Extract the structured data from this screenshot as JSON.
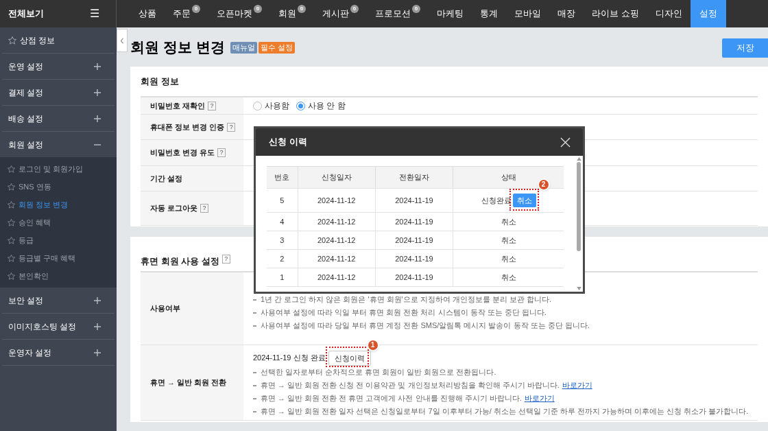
{
  "top_nav": {
    "all_menu_label": "전체보기",
    "menu_icon": "☰",
    "tabs": [
      {
        "label": "상품",
        "selected": false
      },
      {
        "label": "주문",
        "badge": "0",
        "selected": false
      },
      {
        "label": "오픈마켓",
        "badge": "0",
        "selected": false
      },
      {
        "label": "회원",
        "badge": "0",
        "selected": false
      },
      {
        "label": "게시판",
        "badge": "0",
        "selected": false
      },
      {
        "label": "프로모션",
        "badge": "0",
        "selected": false
      },
      {
        "label": "마케팅",
        "selected": false
      },
      {
        "label": "통계",
        "selected": false
      },
      {
        "label": "모바일",
        "selected": false
      },
      {
        "label": "매장",
        "selected": false
      },
      {
        "label": "라이브 쇼핑",
        "selected": false
      },
      {
        "label": "디자인",
        "selected": false
      },
      {
        "label": "설정",
        "selected": true
      }
    ]
  },
  "sidebar": {
    "items": [
      {
        "kind": "favorite",
        "label": "상점 정보"
      },
      {
        "kind": "group",
        "label": "운영 설정",
        "expanded": false
      },
      {
        "kind": "group",
        "label": "결제 설정",
        "expanded": false
      },
      {
        "kind": "group",
        "label": "배송 설정",
        "expanded": false
      },
      {
        "kind": "group",
        "label": "회원 설정",
        "expanded": true,
        "children": [
          {
            "label": "로그인 및 회원가입",
            "selected": false
          },
          {
            "label": "SNS 연동",
            "selected": false
          },
          {
            "label": "회원 정보 변경",
            "selected": true
          },
          {
            "label": "승인 혜택",
            "selected": false
          },
          {
            "label": "등급",
            "selected": false
          },
          {
            "label": "등급별 구매 혜택",
            "selected": false
          },
          {
            "label": "본인확인",
            "selected": false
          }
        ]
      },
      {
        "kind": "group",
        "label": "보안 설정",
        "expanded": false
      },
      {
        "kind": "group",
        "label": "이미지호스팅 설정",
        "expanded": false
      },
      {
        "kind": "group",
        "label": "운영자 설정",
        "expanded": false
      }
    ]
  },
  "page": {
    "title": "회원 정보 변경",
    "badges": [
      {
        "label": "매뉴얼",
        "color": "#6f8fb5"
      },
      {
        "label": "필수 설정",
        "color": "#ee7d2b"
      }
    ],
    "save_button": "저장"
  },
  "member_info": {
    "heading": "회원 정보",
    "rows": [
      {
        "label": "비밀번호 재확인",
        "help": "?",
        "options": [
          {
            "label": "사용함",
            "selected": false
          },
          {
            "label": "사용 안 함",
            "selected": true
          }
        ]
      },
      {
        "label": "휴대폰 정보 변경 인증",
        "help": "?"
      },
      {
        "label": "비밀번호 변경 유도",
        "help": "?"
      },
      {
        "label": "기간 설정"
      },
      {
        "label": "자동 로그아웃",
        "help": "?"
      }
    ]
  },
  "dormant": {
    "heading": "휴면 회원 사용 설정",
    "help": "?",
    "rows": [
      {
        "kind": "notes",
        "label": "사용여부",
        "notes": [
          "1년 간 로그인 하지 않은 회원은 '휴면 회원'으로 지정하여 개인정보를 분리 보관 합니다.",
          "사용여부 설정에 따라 익일 부터 휴면 회원 전환 처리 시스템이 동작 또는 중단 됩니다.",
          "사용여부 설정에 따라 당일 부터 휴면 계정 전환 SMS/알림톡 메시지 발송이 동작 또는 중단 됩니다."
        ]
      },
      {
        "kind": "conversion",
        "label": "휴면 → 일반 회원 전환",
        "status": "2024-11-19 신청 완료",
        "button": "신청이력",
        "callout": "1",
        "notes": [
          {
            "text": "선택한 일자로부터 순차적으로 휴면 회원이 일반 회원으로 전환됩니다."
          },
          {
            "text": "휴면 → 일반 회원 전환 신청 전 이용약관 및 개인정보처리방침을 확인해 주시기 바랍니다.",
            "link": "바로가기"
          },
          {
            "text": "휴면 → 일반 회원 전환 전 휴면 고객에게 사전 안내를 진행해 주시기 바랍니다.",
            "link": "바로가기"
          },
          {
            "text": "휴면 → 일반 회원 전환 일자 선택은 신청일로부터 7일 이후부터 가능/ 취소는 선택일 기준 하루 전까지 가능하며 이후에는 신청 취소가 불가합니다."
          }
        ]
      }
    ]
  },
  "modal": {
    "title": "신청 이력",
    "columns": [
      "번호",
      "신청일자",
      "전환일자",
      "상태"
    ],
    "rows": [
      {
        "number": "5",
        "applied": "2024-11-12",
        "converted": "2024-11-19",
        "status": "신청완료",
        "button": "취소",
        "callout": "2"
      },
      {
        "number": "4",
        "applied": "2024-11-12",
        "converted": "2024-11-19",
        "status": "취소"
      },
      {
        "number": "3",
        "applied": "2024-11-12",
        "converted": "2024-11-19",
        "status": "취소"
      },
      {
        "number": "2",
        "applied": "2024-11-12",
        "converted": "2024-11-19",
        "status": "취소"
      },
      {
        "number": "1",
        "applied": "2024-11-12",
        "converted": "2024-11-19",
        "status": "취소"
      }
    ]
  }
}
